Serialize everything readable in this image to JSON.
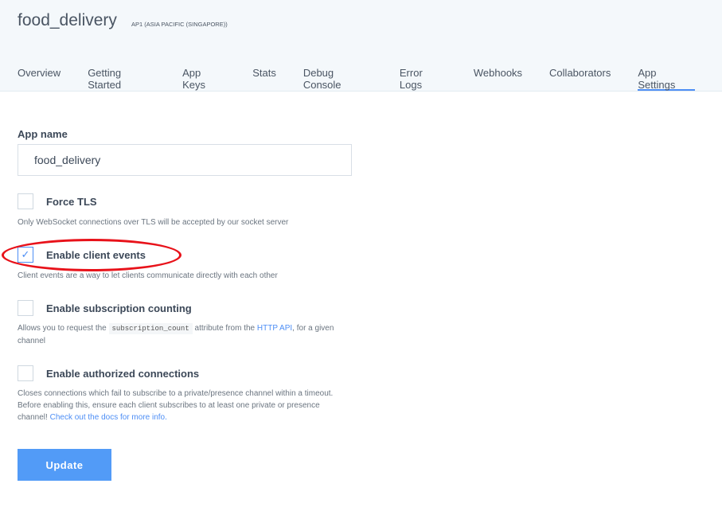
{
  "header": {
    "title": "food_delivery",
    "region": "AP1 (ASIA PACIFIC (SINGAPORE))"
  },
  "tabs": [
    {
      "label": "Overview"
    },
    {
      "label": "Getting Started"
    },
    {
      "label": "App Keys"
    },
    {
      "label": "Stats"
    },
    {
      "label": "Debug Console"
    },
    {
      "label": "Error Logs"
    },
    {
      "label": "Webhooks"
    },
    {
      "label": "Collaborators"
    },
    {
      "label": "App Settings",
      "active": true
    }
  ],
  "form": {
    "app_name_label": "App name",
    "app_name_value": "food_delivery",
    "force_tls": {
      "label": "Force TLS",
      "checked": false,
      "desc": "Only WebSocket connections over TLS will be accepted by our socket server"
    },
    "client_events": {
      "label": "Enable client events",
      "checked": true,
      "desc": "Client events are a way to let clients communicate directly with each other"
    },
    "subscription_counting": {
      "label": "Enable subscription counting",
      "checked": false,
      "desc_pre": "Allows you to request the ",
      "code": "subscription_count",
      "desc_mid": " attribute from the ",
      "link": "HTTP API",
      "desc_post": ", for a given channel"
    },
    "authorized_connections": {
      "label": "Enable authorized connections",
      "checked": false,
      "desc": "Closes connections which fail to subscribe to a private/presence channel within a timeout. Before enabling this, ensure each client subscribes to at least one private or presence channel! ",
      "link": "Check out the docs for more info."
    },
    "update_label": "Update"
  },
  "colors": {
    "accent": "#4d8ef5",
    "annotation": "#e8121a"
  }
}
